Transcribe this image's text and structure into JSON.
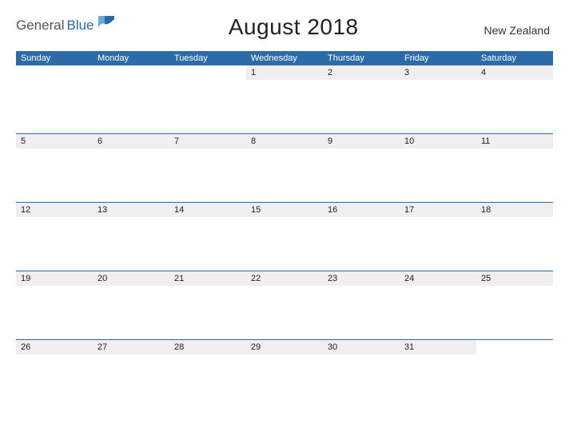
{
  "brand": {
    "general": "General",
    "blue": "Blue"
  },
  "title": "August 2018",
  "region": "New Zealand",
  "colors": {
    "accent": "#2c6aa8",
    "header_bg": "#2c6aa8",
    "numstrip": "#f0eeee"
  },
  "day_headers": [
    "Sunday",
    "Monday",
    "Tuesday",
    "Wednesday",
    "Thursday",
    "Friday",
    "Saturday"
  ],
  "weeks": [
    [
      "",
      "",
      "",
      "1",
      "2",
      "3",
      "4"
    ],
    [
      "5",
      "6",
      "7",
      "8",
      "9",
      "10",
      "11"
    ],
    [
      "12",
      "13",
      "14",
      "15",
      "16",
      "17",
      "18"
    ],
    [
      "19",
      "20",
      "21",
      "22",
      "23",
      "24",
      "25"
    ],
    [
      "26",
      "27",
      "28",
      "29",
      "30",
      "31",
      ""
    ]
  ]
}
